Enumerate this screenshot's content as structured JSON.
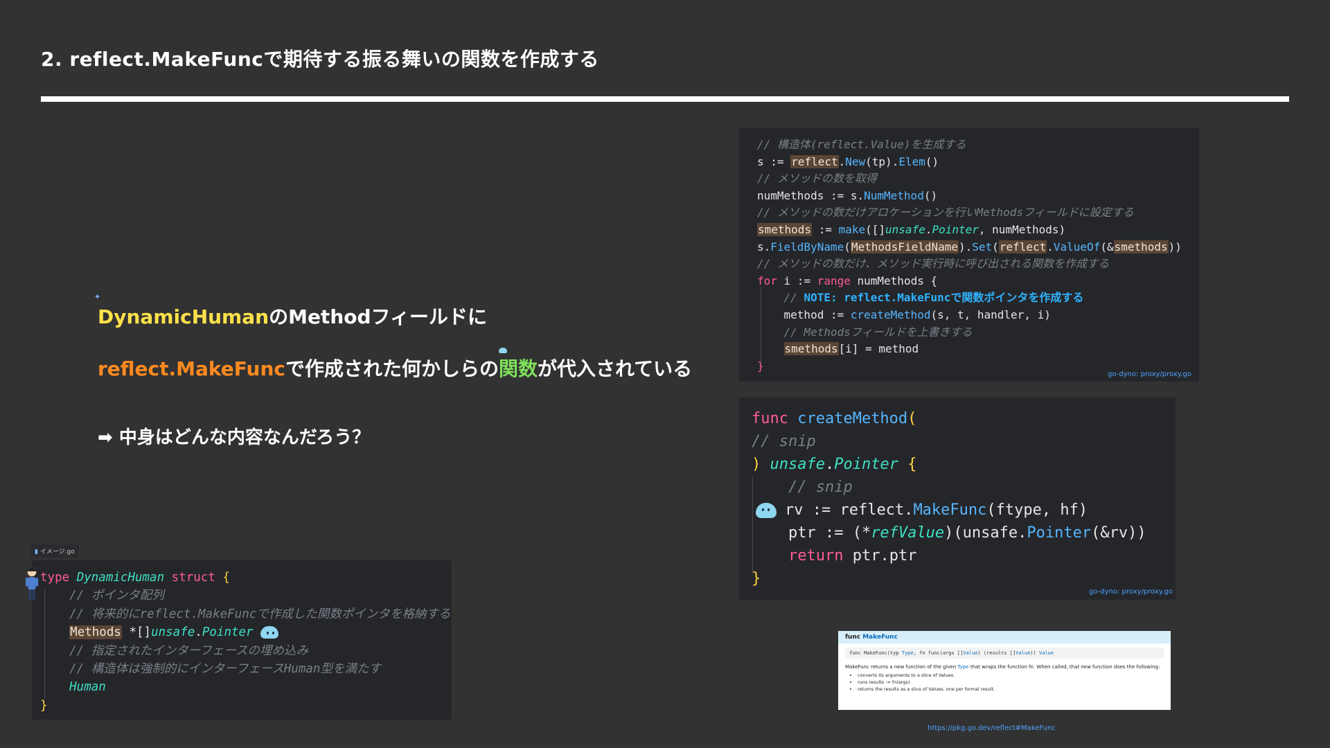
{
  "slide": {
    "title": "2. reflect.MakeFuncで期待する振る舞いの関数を作成する"
  },
  "lead": {
    "line1_a": "DynamicHuman",
    "line1_b": "のMethodフィールドに",
    "line2_a": "reflect.MakeFunc",
    "line2_b": "で作成された何かしらの",
    "line2_c": "関数",
    "line2_d": "が代入されている",
    "line3": "➡ 中身はどんな内容なんだろう？"
  },
  "code_top": {
    "l1": "// 構造体(reflect.Value)を生成する",
    "l2_a": "s := ",
    "l2_b": "reflect",
    "l2_c": ".",
    "l2_d": "New",
    "l2_e": "(tp).",
    "l2_f": "Elem",
    "l2_g": "()",
    "l3": "// メソッドの数を取得",
    "l4_a": "numMethods := s.",
    "l4_b": "NumMethod",
    "l4_c": "()",
    "l5": "// メソッドの数だけアロケーションを行いMethodsフィールドに設定する",
    "l6_a": "smethods",
    "l6_b": " := ",
    "l6_c": "make",
    "l6_d": "([]",
    "l6_e": "unsafe",
    "l6_f": ".",
    "l6_g": "Pointer",
    "l6_h": ", numMethods)",
    "l7_a": "s.",
    "l7_b": "FieldByName",
    "l7_c": "(",
    "l7_d": "MethodsFieldName",
    "l7_e": ").",
    "l7_f": "Set",
    "l7_g": "(",
    "l7_h": "reflect",
    "l7_i": ".",
    "l7_j": "ValueOf",
    "l7_k": "(&",
    "l7_l": "smethods",
    "l7_m": "))",
    "l8": "// メソッドの数だけ、メソッド実行時に呼び出される関数を作成する",
    "l9_a": "for",
    "l9_b": " i := ",
    "l9_c": "range",
    "l9_d": " numMethods {",
    "l10_a": "    // ",
    "l10_b": "NOTE: reflect.MakeFuncで関数ポインタを作成する",
    "l11_a": "    method := ",
    "l11_b": "createMethod",
    "l11_c": "(s, t, handler, i)",
    "l12": "    // Methodsフィールドを上書きする",
    "l13_a": "    ",
    "l13_b": "smethods",
    "l13_c": "[i] = method",
    "l14": "}",
    "caption": "go-dyno: proxy/proxy.go"
  },
  "code_mid": {
    "l1_a": "func",
    "l1_b": " createMethod",
    "l1_c": "(",
    "l2": "// snip",
    "l3_a": ") ",
    "l3_b": "unsafe",
    "l3_c": ".",
    "l3_d": "Pointer",
    "l3_e": " {",
    "l4": "    // snip",
    "l5_a": "rv := reflect.",
    "l5_b": "MakeFunc",
    "l5_c": "(ftype, hf)",
    "l6_a": "    ptr := (*",
    "l6_b": "refValue",
    "l6_c": ")(unsafe.",
    "l6_d": "Pointer",
    "l6_e": "(&rv))",
    "l7_a": "    ",
    "l7_b": "return",
    "l7_c": " ptr.ptr",
    "l8": "}",
    "caption": "go-dyno: proxy/proxy.go"
  },
  "doc": {
    "head_a": "func ",
    "head_b": "MakeFunc",
    "sig_a": "func MakeFunc(typ ",
    "sig_b": "Type",
    "sig_c": ", fn func(args []",
    "sig_d": "Value",
    "sig_e": ") (results []",
    "sig_f": "Value",
    "sig_g": ")) ",
    "sig_h": "Value",
    "desc_a": "MakeFunc returns a new function of the given ",
    "desc_b": "Type",
    "desc_c": " that wraps the function fn. When called, that new function does the following:",
    "bullets": [
      "converts its arguments to a slice of Values.",
      "runs results := fn(args).",
      "returns the results as a slice of Values, one per formal result."
    ],
    "caption": "https://pkg.go.dev/reflect#MakeFunc"
  },
  "code_left": {
    "tab": "イメージ.go",
    "l1_a": "type",
    "l1_b": " DynamicHuman",
    "l1_c": " struct",
    "l1_d": " {",
    "l2": "    // ポインタ配列",
    "l3": "    // 将来的にreflect.MakeFuncで作成した関数ポインタを格納する",
    "l4_a": "    ",
    "l4_b": "Methods",
    "l4_c": " *[]",
    "l4_d": "unsafe",
    "l4_e": ".",
    "l4_f": "Pointer",
    "l5": "    // 指定されたインターフェースの埋め込み",
    "l6": "    // 構造体は強制的にインターフェースHuman型を満たす",
    "l7": "    Human",
    "l8": "}"
  },
  "colors": {
    "background": "#323232",
    "code_bg": "#25262a",
    "keyword": "#ff5c93",
    "function": "#55b6ff",
    "type": "#3ee0c2",
    "brace": "#ffd23f",
    "highlight": "#5b4636",
    "lead_yellow": "#ffe14a",
    "lead_orange": "#ff8a1f",
    "lead_green": "#7ee05a"
  },
  "icons": [
    "blob-character-icon",
    "person-figure-icon",
    "file-tab-icon"
  ]
}
